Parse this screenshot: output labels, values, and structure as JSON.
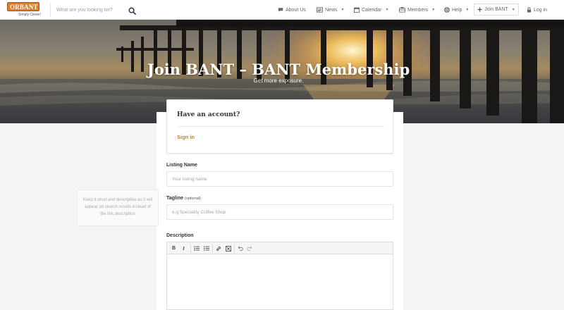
{
  "header": {
    "logo_text": "ORBANT",
    "logo_tagline": "Simply Clever!",
    "search_placeholder": "What are you looking for?",
    "nav": {
      "about": "About Us",
      "news": "News",
      "calendar": "Calendar",
      "members": "Members",
      "help": "Help",
      "join": "Join BANT",
      "login": "Log in"
    }
  },
  "hero": {
    "title": "Join BANT – BANT Membership",
    "subtitle": "Get more exposure."
  },
  "account": {
    "title": "Have an account?",
    "sign_in": "Sign in"
  },
  "form": {
    "listing_name_label": "Listing Name",
    "listing_name_placeholder": "Your listing name",
    "tagline_label": "Tagline",
    "tagline_optional": "(optional)",
    "tagline_placeholder": "e.g Speciality Coffee Shop",
    "tagline_hint": "Keep it short and descriptive as it will appear on search results instead of the link description",
    "description_label": "Description"
  },
  "colors": {
    "accent": "#b38a37",
    "logo_orange": "#d9802a"
  },
  "icons": {
    "search": "search-icon",
    "about": "comment-icon",
    "news": "newspaper-icon",
    "calendar": "calendar-icon",
    "members": "members-icon",
    "help": "lifebuoy-icon",
    "join": "plus-icon",
    "login": "lock-icon"
  }
}
